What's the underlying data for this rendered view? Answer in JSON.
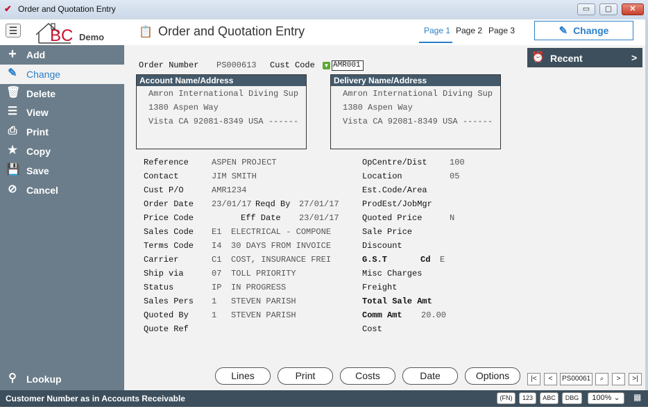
{
  "window": {
    "title": "Order and Quotation Entry",
    "min": "▭",
    "max": "▢",
    "close": "✕"
  },
  "header": {
    "menu_icon": "☰",
    "logo_text": "BC",
    "logo_sub": "Demo",
    "page_title": "Order and Quotation Entry",
    "tabs": [
      "Page 1",
      "Page 2",
      "Page 3"
    ],
    "change_label": "Change"
  },
  "sidebar": {
    "items": [
      {
        "label": "Add",
        "icon": "plus-icon"
      },
      {
        "label": "Change",
        "icon": "pencil-icon"
      },
      {
        "label": "Delete",
        "icon": "trash-icon"
      },
      {
        "label": "View",
        "icon": "list-icon"
      },
      {
        "label": "Print",
        "icon": "printer-icon"
      },
      {
        "label": "Copy",
        "icon": "star-icon"
      },
      {
        "label": "Save",
        "icon": "floppy-icon"
      },
      {
        "label": "Cancel",
        "icon": "cancel-icon"
      }
    ],
    "lookup": "Lookup"
  },
  "recent": {
    "label": "Recent",
    "chevron": ">"
  },
  "order": {
    "order_number_label": "Order Number",
    "order_number": "PS000613",
    "cust_code_label": "Cust Code",
    "cust_code": "AMR001"
  },
  "account": {
    "title": "Account Name/Address",
    "lines": [
      "Amron International Diving Sup",
      "1380 Aspen Way",
      "Vista CA 92081-8349 USA ------"
    ]
  },
  "delivery": {
    "title": "Delivery Name/Address",
    "lines": [
      "Amron International Diving Sup",
      "1380 Aspen Way",
      "Vista CA 92081-8349 USA ------"
    ]
  },
  "left_fields": [
    {
      "label": "Reference",
      "code": "",
      "value": "ASPEN PROJECT"
    },
    {
      "label": "Contact",
      "code": "",
      "value": "JIM SMITH"
    },
    {
      "label": "Cust P/O",
      "code": "",
      "value": "AMR1234"
    },
    {
      "label": "Order Date",
      "code": "",
      "value": "23/01/17"
    },
    {
      "label": "Price Code",
      "code": "",
      "value": ""
    },
    {
      "label": "Sales Code",
      "code": "E1",
      "value": "ELECTRICAL - COMPONE"
    },
    {
      "label": "Terms Code",
      "code": "I4",
      "value": "30 DAYS FROM INVOICE"
    },
    {
      "label": "Carrier",
      "code": "C1",
      "value": "COST, INSURANCE FREI"
    },
    {
      "label": "Ship via",
      "code": "07",
      "value": "TOLL PRIORITY"
    },
    {
      "label": "Status",
      "code": "IP",
      "value": "IN PROGRESS"
    },
    {
      "label": "Sales Pers",
      "code": "1",
      "value": "STEVEN PARISH"
    },
    {
      "label": "Quoted By",
      "code": "1",
      "value": "STEVEN PARISH"
    },
    {
      "label": "Quote Ref",
      "code": "",
      "value": ""
    }
  ],
  "reqd_by": {
    "label": "Reqd By",
    "value": "27/01/17"
  },
  "eff_date": {
    "label": "Eff Date",
    "value": "23/01/17"
  },
  "right_fields": [
    {
      "label": "OpCentre/Dist",
      "value": "100"
    },
    {
      "label": "Location",
      "value": "05"
    },
    {
      "label": "Est.Code/Area",
      "value": ""
    },
    {
      "label": "ProdEst/JobMgr",
      "value": ""
    },
    {
      "label": "Quoted Price",
      "value": "N"
    },
    {
      "label": "Sale Price",
      "value": ""
    },
    {
      "label": "Discount",
      "value": ""
    },
    {
      "label": "G.S.T",
      "value": ""
    },
    {
      "label": "Misc Charges",
      "value": ""
    },
    {
      "label": "Freight",
      "value": ""
    },
    {
      "label": "Total Sale Amt",
      "value": ""
    },
    {
      "label": "Comm Amt",
      "value": "20.00"
    },
    {
      "label": "Cost",
      "value": ""
    }
  ],
  "gst_cd": {
    "label": "Cd",
    "value": "E"
  },
  "actions": [
    "Lines",
    "Print",
    "Costs",
    "Date",
    "Options"
  ],
  "nav": {
    "first": "|<",
    "prev": "<",
    "field": "PS00061",
    "search": "⌕",
    "next": ">",
    "last": ">|"
  },
  "status": {
    "text": "Customer Number as in Accounts Receivable",
    "fn": "(FN)",
    "num": "123",
    "abc": "ABC",
    "dbg": "DBG",
    "zoom": "100%",
    "zoom_caret": "⌄",
    "grid_icon": "▦"
  },
  "colors": {
    "accent": "#2a7fc9",
    "sidebar": "#6b7d8a",
    "dark": "#3d4f5c",
    "header_box": "#445a6b"
  }
}
